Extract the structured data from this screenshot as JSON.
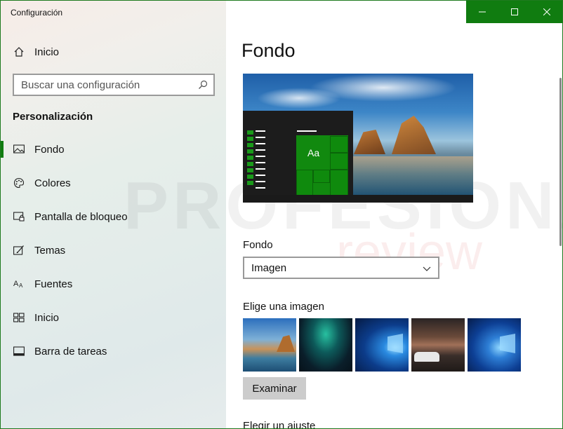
{
  "window": {
    "title": "Configuración",
    "accent": "#107c10"
  },
  "sidebar": {
    "home_label": "Inicio",
    "search_placeholder": "Buscar una configuración",
    "section": "Personalización",
    "items": [
      {
        "label": "Fondo",
        "icon": "picture-icon",
        "active": true
      },
      {
        "label": "Colores",
        "icon": "palette-icon"
      },
      {
        "label": "Pantalla de bloqueo",
        "icon": "lock-screen-icon"
      },
      {
        "label": "Temas",
        "icon": "brush-icon"
      },
      {
        "label": "Fuentes",
        "icon": "font-icon"
      },
      {
        "label": "Inicio",
        "icon": "start-icon"
      },
      {
        "label": "Barra de tareas",
        "icon": "taskbar-icon"
      }
    ]
  },
  "main": {
    "title": "Fondo",
    "preview": {
      "tile_text": "Aa"
    },
    "background_label": "Fondo",
    "background_value": "Imagen",
    "choose_image_label": "Elige una imagen",
    "thumbnails": [
      "beach-rocks",
      "aurora",
      "windows-light-blue",
      "street-car",
      "windows-blue"
    ],
    "browse_button": "Examinar",
    "fit_label": "Elegir un ajuste"
  },
  "watermark": {
    "line1": "PROFESIONAL",
    "line2": "review"
  }
}
